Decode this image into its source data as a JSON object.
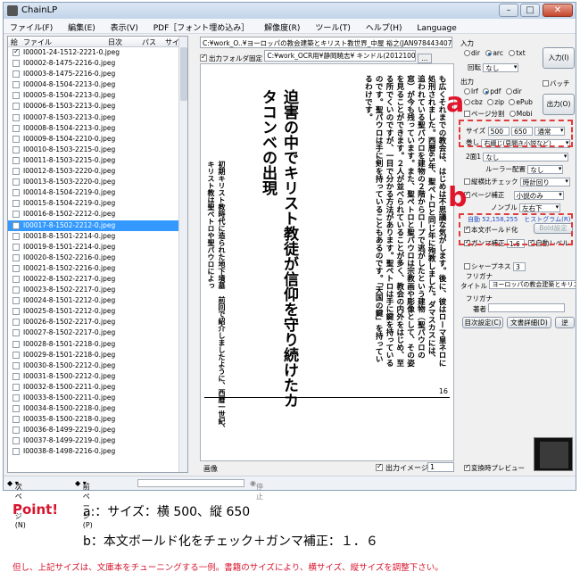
{
  "window": {
    "title": "ChainLP",
    "buttons": {
      "minimize": "–",
      "maximize": "□",
      "close": "✕"
    }
  },
  "menu": [
    "ファイル(F)",
    "編集(E)",
    "表示(V)",
    "PDF［フォント埋め込み］",
    "解像度(R)",
    "ツール(T)",
    "ヘルプ(H)",
    "Language"
  ],
  "filelist": {
    "headers": [
      "絵",
      "ファイル",
      "日次",
      "パス",
      "サイ"
    ],
    "rows": [
      {
        "name": "I00001-24-1512-2221-0.jpeg",
        "checked": true,
        "selected": false
      },
      {
        "name": "I00002-8-1475-2216-0.jpeg",
        "checked": false,
        "selected": false
      },
      {
        "name": "I00003-8-1475-2216-0.jpeg",
        "checked": false,
        "selected": false
      },
      {
        "name": "I00004-8-1504-2213-0.jpeg",
        "checked": false,
        "selected": false
      },
      {
        "name": "I00005-8-1504-2213-0.jpeg",
        "checked": false,
        "selected": false
      },
      {
        "name": "I00006-8-1503-2213-0.jpeg",
        "checked": false,
        "selected": false
      },
      {
        "name": "I00007-8-1503-2213-0.jpeg",
        "checked": false,
        "selected": false
      },
      {
        "name": "I00008-8-1504-2213-0.jpeg",
        "checked": false,
        "selected": false
      },
      {
        "name": "I00009-8-1504-2210-0.jpeg",
        "checked": false,
        "selected": false
      },
      {
        "name": "I00010-8-1503-2215-0.jpeg",
        "checked": false,
        "selected": false
      },
      {
        "name": "I00011-8-1503-2215-0.jpeg",
        "checked": false,
        "selected": false
      },
      {
        "name": "I00012-8-1503-2220-0.jpeg",
        "checked": false,
        "selected": false
      },
      {
        "name": "I00013-8-1503-2220-0.jpeg",
        "checked": false,
        "selected": false
      },
      {
        "name": "I00014-8-1504-2219-0.jpeg",
        "checked": false,
        "selected": false
      },
      {
        "name": "I00015-8-1504-2219-0.jpeg",
        "checked": false,
        "selected": false
      },
      {
        "name": "I00016-8-1502-2212-0.jpeg",
        "checked": false,
        "selected": false
      },
      {
        "name": "I00017-8-1502-2212-0.jpeg",
        "checked": false,
        "selected": true
      },
      {
        "name": "I00018-8-1501-2214-0.jpeg",
        "checked": false,
        "selected": false
      },
      {
        "name": "I00019-8-1501-2214-0.jpeg",
        "checked": false,
        "selected": false
      },
      {
        "name": "I00020-8-1502-2216-0.jpeg",
        "checked": false,
        "selected": false
      },
      {
        "name": "I00021-8-1502-2216-0.jpeg",
        "checked": false,
        "selected": false
      },
      {
        "name": "I00022-8-1502-2217-0.jpeg",
        "checked": false,
        "selected": false
      },
      {
        "name": "I00023-8-1502-2217-0.jpeg",
        "checked": false,
        "selected": false
      },
      {
        "name": "I00024-8-1501-2212-0.jpeg",
        "checked": false,
        "selected": false
      },
      {
        "name": "I00025-8-1501-2212-0.jpeg",
        "checked": false,
        "selected": false
      },
      {
        "name": "I00026-8-1502-2217-0.jpeg",
        "checked": false,
        "selected": false
      },
      {
        "name": "I00027-8-1502-2217-0.jpeg",
        "checked": false,
        "selected": false
      },
      {
        "name": "I00028-8-1501-2218-0.jpeg",
        "checked": false,
        "selected": false
      },
      {
        "name": "I00029-8-1501-2218-0.jpeg",
        "checked": false,
        "selected": false
      },
      {
        "name": "I00030-8-1500-2212-0.jpeg",
        "checked": false,
        "selected": false
      },
      {
        "name": "I00031-8-1500-2212-0.jpeg",
        "checked": false,
        "selected": false
      },
      {
        "name": "I00032-8-1500-2211-0.jpeg",
        "checked": false,
        "selected": false
      },
      {
        "name": "I00033-8-1500-2211-0.jpeg",
        "checked": false,
        "selected": false
      },
      {
        "name": "I00034-8-1500-2218-0.jpeg",
        "checked": false,
        "selected": false
      },
      {
        "name": "I00035-8-1500-2218-0.jpeg",
        "checked": false,
        "selected": false
      },
      {
        "name": "I00036-8-1499-2219-0.jpeg",
        "checked": false,
        "selected": false
      },
      {
        "name": "I00037-8-1499-2219-0.jpeg",
        "checked": false,
        "selected": false
      },
      {
        "name": "I00038-8-1498-2216-0.jpeg",
        "checked": false,
        "selected": false
      }
    ]
  },
  "center": {
    "input_path": "C:¥work_O..¥ヨーロッパの教会建築とキリスト教世界_中屋 裕之(JAN9784434079184).pdf",
    "output_label": "出力フォルダ固定",
    "output_path": "C:¥work_OCR用¥静岡曉志¥ キンドル(20121009 1..¥kindle",
    "dots": "...",
    "body_text": "も広くそれまでの教会は、はじめは不思議な気がします。後に、彼はローマ皇ネロに処刑されました。西暦65年、聖ペトロと同じ年に殉教しました。ダマスカスには、追われている聖パウロを建物の２階からロープで逃がしたという建物（聖パウロの窓）が今も残っています。また、聖ペトロと聖パウロは宗教画や彫像として、その姿を見ることができます。２人が並べられていることが多く、教会の内外をはじめ、至る所でくいのですが、一目で分かる方法があります。聖ペトロは手に鍵を持っているのです。聖パウロは手に剣を持っていることもあるのです。「天国の鍵」を持っているわけです。",
    "heading": "迫害の中でキリスト教徒が信仰を守り続けたカタコンベの出現",
    "subsection": "初期キリスト教時代に造られた地下墳墓　前回で紹介しましたように、西暦一世紀、キリスト教は聖ペトロや聖パウロによっ",
    "page_number": "16",
    "bottom_label": "画像",
    "output_image_label": "出力イメージ",
    "page_select": "1"
  },
  "right": {
    "input_label": "入力",
    "input_radios": [
      {
        "label": "dir",
        "on": false
      },
      {
        "label": "arc",
        "on": true
      },
      {
        "label": "txt",
        "on": false
      }
    ],
    "rotate_label": "回転",
    "rotate_value": "なし",
    "input_button": "入力(I)",
    "batch_label": "バッチ",
    "output_label": "出力",
    "output_radios": [
      {
        "label": "lrf",
        "on": false
      },
      {
        "label": "pdf",
        "on": true
      },
      {
        "label": "dir",
        "on": false
      }
    ],
    "output_radios2": [
      {
        "label": "cbz",
        "on": false
      },
      {
        "label": "zip",
        "on": false
      },
      {
        "label": "ePub",
        "on": false
      }
    ],
    "page_split_label": "ページ分割",
    "mobi_label": "Mobi",
    "output_button": "出力(O)",
    "size_label": "サイズ",
    "width": "500",
    "height": "650",
    "size_mode": "通常",
    "trim_label": "巻し",
    "trim_value": "右綴じ(見開き小説など)",
    "split_label": "2面1",
    "split_value": "なし",
    "ruler_label": "ルーラー配置",
    "ruler_value": "なし",
    "ratio_label": "縦横比チェック",
    "ratio_value": "時計回り",
    "page_correction_label": "ページ補正",
    "page_correction_value": "小説のみ",
    "nonbull_label": "ノンブル",
    "nonbull_value": "左右下",
    "auto_info": "自動 52,158,255　ヒストグラム(R)",
    "bold_label": "本文ボールド化",
    "bold_button": "Bold設定",
    "gamma_label": "ガンマ補正",
    "gamma_value": "1.6",
    "auto_level_label": "自動レベル",
    "sharp_label": "シャープネス",
    "sharp_value": "3",
    "furigana_label": "フリガナ",
    "title_label": "タイトル",
    "title_value": "ヨーロッパの教会建築とキリスト",
    "furigana2_label": "フリガナ",
    "author_label": "著者",
    "author_value": "",
    "toc_button": "目次設定(C)",
    "doc_button": "文書詳細(D)",
    "extra_button": "逆",
    "thumb_label": "変換時プレビュー"
  },
  "status": {
    "next": "次ページ(N)",
    "prev": "前ページ(P)",
    "stop": "停止",
    "progress": 0
  },
  "annotations": {
    "badge_a": "a",
    "badge_b": "b",
    "accent": "#e0142a"
  },
  "captions": {
    "point": "Point!",
    "line1": "a:：サイズ：横 500、縦 650",
    "line2": "b：本文ボールド化をチェック＋ガンマ補正：１．６",
    "note": "但し、上記サイズは、文庫本をチューニングする一例。書籍のサイズにより、横サイズ、縦サイズを調整下さい。"
  }
}
